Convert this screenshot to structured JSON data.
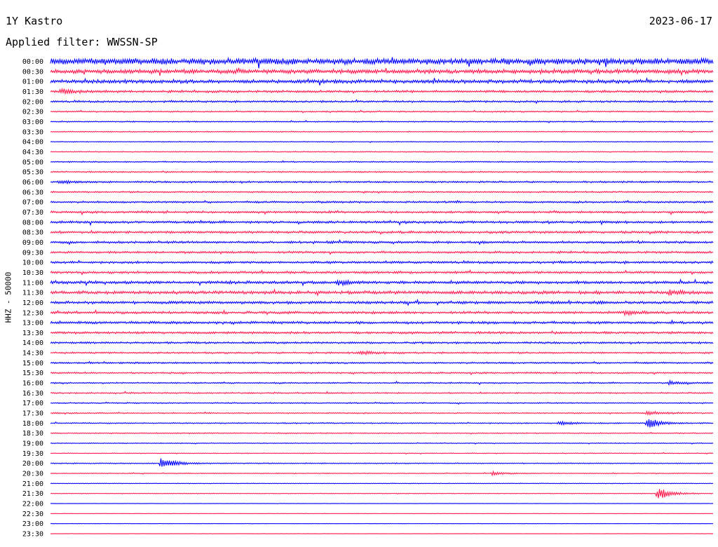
{
  "header": {
    "station": "1Y Kastro",
    "date": "2023-06-17",
    "filter_label": "Applied filter: WWSSN-SP"
  },
  "chart_data": {
    "type": "line",
    "title": "1Y Kastro",
    "ylabel": "HHZ - 50000",
    "line_colors": [
      "#0000ff",
      "#ff1a4d"
    ],
    "trace_labels": [
      "00:00",
      "00:30",
      "01:00",
      "01:30",
      "02:00",
      "02:30",
      "03:00",
      "03:30",
      "04:00",
      "04:30",
      "05:00",
      "05:30",
      "06:00",
      "06:30",
      "07:00",
      "07:30",
      "08:00",
      "08:30",
      "09:00",
      "09:30",
      "10:00",
      "10:30",
      "11:00",
      "11:30",
      "12:00",
      "12:30",
      "13:00",
      "13:30",
      "14:00",
      "14:30",
      "15:00",
      "15:30",
      "16:00",
      "16:30",
      "17:00",
      "17:30",
      "18:00",
      "18:30",
      "19:00",
      "19:30",
      "20:00",
      "20:30",
      "21:00",
      "21:30",
      "22:00",
      "22:30",
      "23:00",
      "23:30"
    ],
    "trace_amplitude_level": [
      3.2,
      2.2,
      1.9,
      1.2,
      1.0,
      0.7,
      0.6,
      0.5,
      0.4,
      0.5,
      0.6,
      0.7,
      0.9,
      0.8,
      1.0,
      1.1,
      1.2,
      1.2,
      1.2,
      1.1,
      1.2,
      1.2,
      1.5,
      1.6,
      1.5,
      1.3,
      1.3,
      1.2,
      1.0,
      0.9,
      0.9,
      0.8,
      0.7,
      0.7,
      0.6,
      0.6,
      0.6,
      0.5,
      0.4,
      0.4,
      0.5,
      0.4,
      0.3,
      0.3,
      0.2,
      0.2,
      0.2,
      0.2
    ],
    "events": [
      {
        "trace": "01:30",
        "minute": 0.5,
        "amplitude": 3.0
      },
      {
        "trace": "06:00",
        "minute": 0.4,
        "amplitude": 2.0
      },
      {
        "trace": "11:00",
        "minute": 13.0,
        "amplitude": 3.0
      },
      {
        "trace": "11:30",
        "minute": 28.0,
        "amplitude": 2.5
      },
      {
        "trace": "12:30",
        "minute": 26.0,
        "amplitude": 3.2
      },
      {
        "trace": "14:30",
        "minute": 14.0,
        "amplitude": 2.5
      },
      {
        "trace": "16:00",
        "minute": 28.0,
        "amplitude": 3.0
      },
      {
        "trace": "17:30",
        "minute": 27.0,
        "amplitude": 3.5
      },
      {
        "trace": "18:00",
        "minute": 27.0,
        "amplitude": 8.0
      },
      {
        "trace": "18:00",
        "minute": 23.0,
        "amplitude": 3.0
      },
      {
        "trace": "20:00",
        "minute": 5.0,
        "amplitude": 9.0
      },
      {
        "trace": "20:30",
        "minute": 20.0,
        "amplitude": 2.5
      },
      {
        "trace": "21:30",
        "minute": 27.5,
        "amplitude": 9.0
      }
    ]
  }
}
